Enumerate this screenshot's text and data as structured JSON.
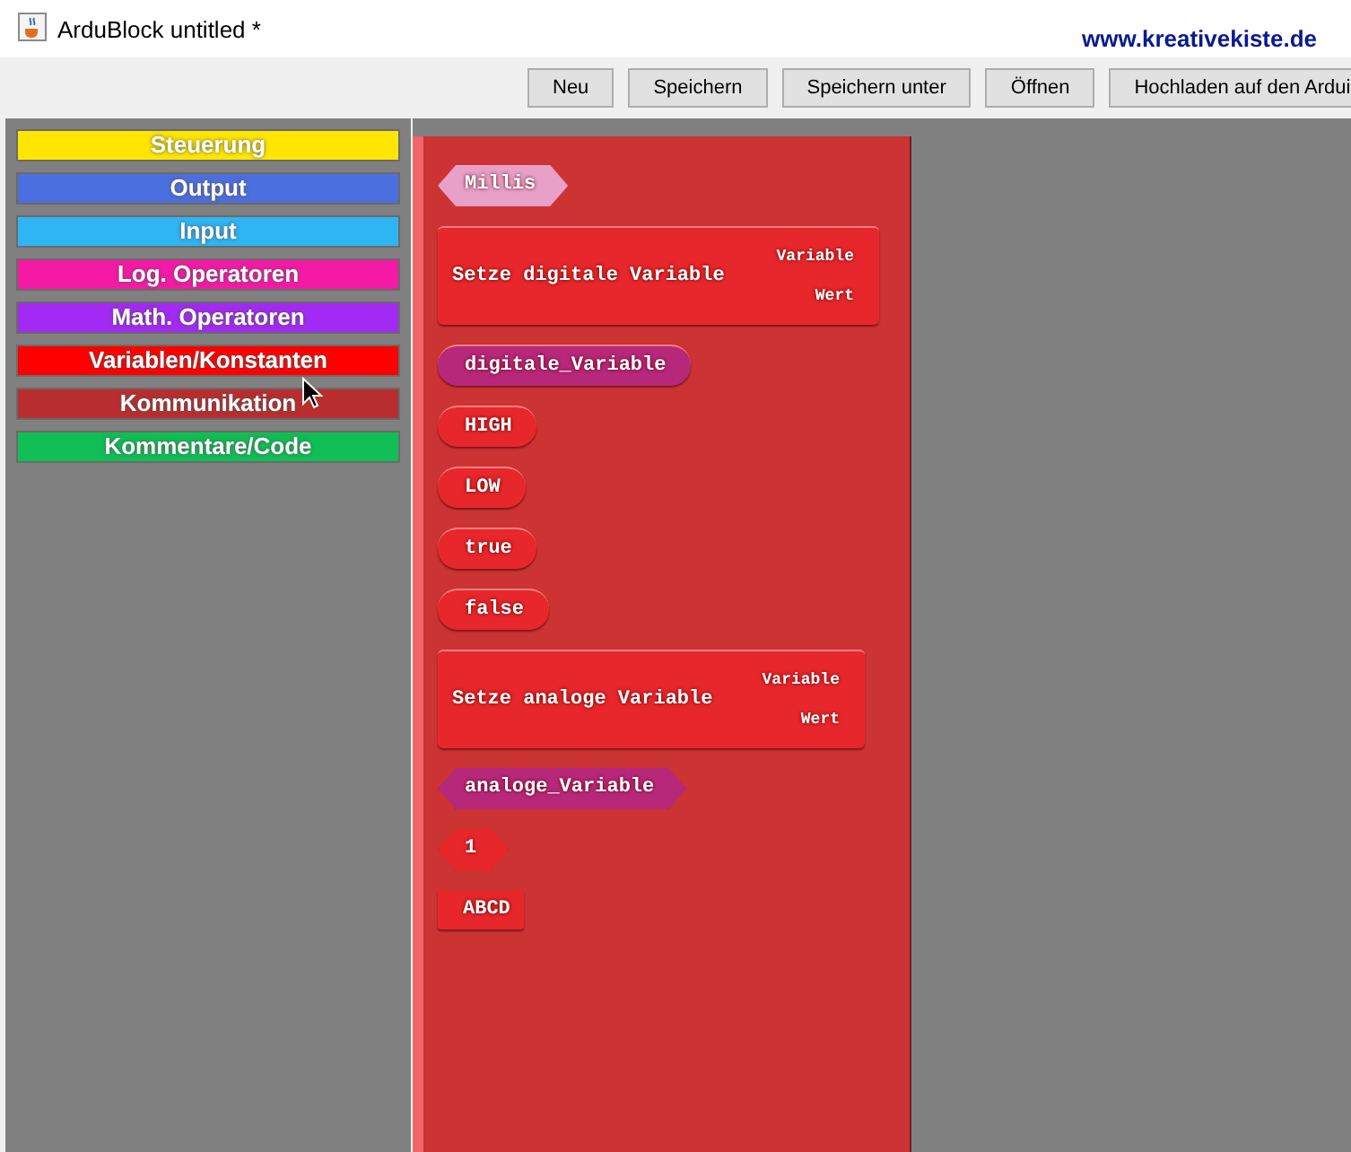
{
  "window": {
    "title": "ArduBlock untitled *",
    "website": "www.kreativekiste.de"
  },
  "toolbar": [
    "Neu",
    "Speichern",
    "Speichern unter",
    "Öffnen",
    "Hochladen auf den Ardui"
  ],
  "categories": [
    {
      "label": "Steuerung",
      "color": "#ffe600"
    },
    {
      "label": "Output",
      "color": "#4c6fe0"
    },
    {
      "label": "Input",
      "color": "#2fb4f4"
    },
    {
      "label": "Log. Operatoren",
      "color": "#f41aa6"
    },
    {
      "label": "Math. Operatoren",
      "color": "#a22af2"
    },
    {
      "label": "Variablen/Konstanten",
      "color": "#ff0000"
    },
    {
      "label": "Kommunikation",
      "color": "#b82e2e"
    },
    {
      "label": "Kommentare/Code",
      "color": "#0fbf55"
    }
  ],
  "blocks": [
    {
      "kind": "hex",
      "text": "Millis",
      "color": "#e8a0c8"
    },
    {
      "kind": "command",
      "text": "Setze digitale Variable",
      "sockets": [
        "Variable",
        "Wert"
      ],
      "color": "#e8272c"
    },
    {
      "kind": "round",
      "text": "digitale_Variable",
      "color": "#b8287a"
    },
    {
      "kind": "round",
      "text": "HIGH",
      "color": "#e8272c"
    },
    {
      "kind": "round",
      "text": "LOW",
      "color": "#e8272c"
    },
    {
      "kind": "round",
      "text": "true",
      "color": "#e8272c"
    },
    {
      "kind": "round",
      "text": "false",
      "color": "#e8272c"
    },
    {
      "kind": "command",
      "text": "Setze analoge Variable",
      "sockets": [
        "Variable",
        "Wert"
      ],
      "color": "#e8272c"
    },
    {
      "kind": "hex",
      "text": "analoge_Variable",
      "color": "#b8287a"
    },
    {
      "kind": "hex",
      "text": "1",
      "color": "#e8272c"
    },
    {
      "kind": "string",
      "text": "ABCD",
      "color": "#e8272c"
    }
  ]
}
